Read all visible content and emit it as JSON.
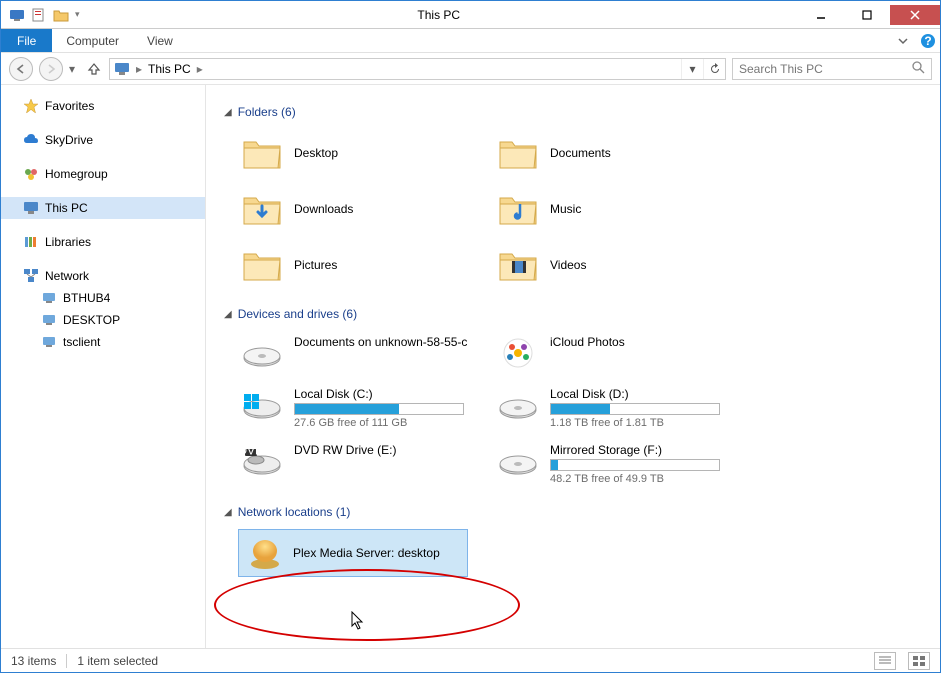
{
  "window": {
    "title": "This PC"
  },
  "ribbon": {
    "file": "File",
    "tabs": [
      "Computer",
      "View"
    ]
  },
  "address": {
    "location": "This PC",
    "search_placeholder": "Search This PC"
  },
  "nav": {
    "favorites": "Favorites",
    "skydrive": "SkyDrive",
    "homegroup": "Homegroup",
    "thispc": "This PC",
    "libraries": "Libraries",
    "network": "Network",
    "network_children": [
      "BTHUB4",
      "DESKTOP",
      "tsclient"
    ]
  },
  "sections": {
    "folders": {
      "title": "Folders (6)"
    },
    "drives": {
      "title": "Devices and drives (6)"
    },
    "netloc": {
      "title": "Network locations (1)"
    }
  },
  "folders": [
    {
      "name": "Desktop"
    },
    {
      "name": "Documents"
    },
    {
      "name": "Downloads"
    },
    {
      "name": "Music"
    },
    {
      "name": "Pictures"
    },
    {
      "name": "Videos"
    }
  ],
  "drives": [
    {
      "name": "Documents on unknown-58-55-c",
      "bar": false
    },
    {
      "name": "iCloud Photos",
      "bar": false
    },
    {
      "name": "Local Disk (C:)",
      "bar": true,
      "pct": 62,
      "free": "27.6 GB free of 111 GB"
    },
    {
      "name": "Local Disk (D:)",
      "bar": true,
      "pct": 35,
      "free": "1.18 TB free of 1.81 TB"
    },
    {
      "name": "DVD RW Drive (E:)",
      "bar": false
    },
    {
      "name": "Mirrored Storage (F:)",
      "bar": true,
      "pct": 4,
      "free": "48.2 TB free of 49.9 TB"
    }
  ],
  "netloc": [
    {
      "name": "Plex Media Server: desktop"
    }
  ],
  "status": {
    "count": "13 items",
    "selected": "1 item selected"
  }
}
